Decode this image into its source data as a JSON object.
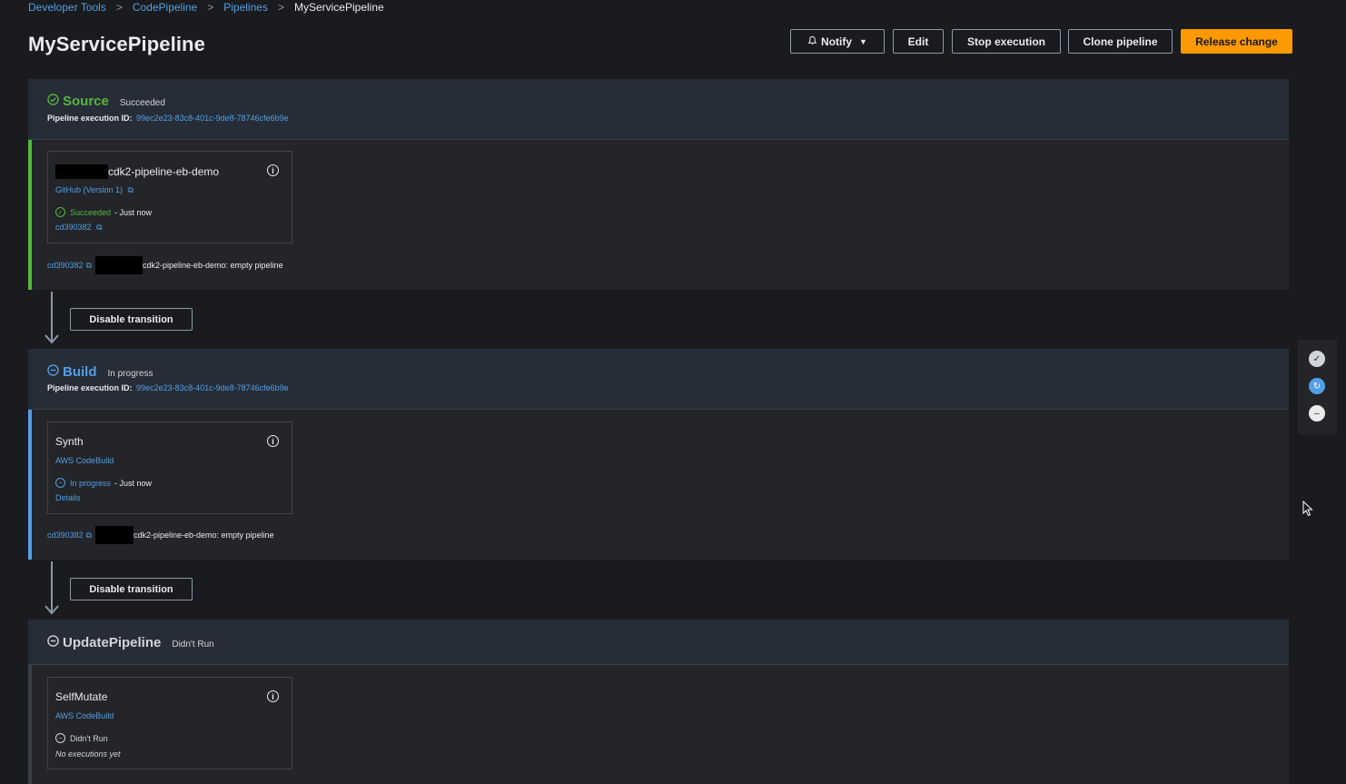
{
  "breadcrumb": {
    "items": [
      "Developer Tools",
      "CodePipeline",
      "Pipelines"
    ],
    "current": "MyServicePipeline"
  },
  "page": {
    "title": "MyServicePipeline"
  },
  "header_buttons": {
    "notify": "Notify",
    "edit": "Edit",
    "stop": "Stop execution",
    "clone": "Clone pipeline",
    "release": "Release change"
  },
  "colors": {
    "success": "#57b53c",
    "in_progress": "#539fe5",
    "didnt_run": "#d1d5db",
    "primary_button": "#ff9900"
  },
  "stages": [
    {
      "name": "Source",
      "status": "Succeeded",
      "exec_label": "Pipeline execution ID:",
      "exec_id": "99ec2e23-83c8-401c-9de8-78746cfe6b9e",
      "action": {
        "name": "cdk2-pipeline-eb-demo",
        "provider": "GitHub (Version 1)",
        "status": "Succeeded",
        "time": "- Just now",
        "sub": "cd390382"
      },
      "commit": {
        "id": "cd390382",
        "message": "cdk2-pipeline-eb-demo: empty pipeline"
      }
    },
    {
      "name": "Build",
      "status": "In progress",
      "exec_label": "Pipeline execution ID:",
      "exec_id": "99ec2e23-83c8-401c-9de8-78746cfe6b9e",
      "action": {
        "name": "Synth",
        "provider": "AWS CodeBuild",
        "status": "In progress",
        "time": "- Just now",
        "sub": "Details"
      },
      "commit": {
        "id": "cd390382",
        "message": "cdk2-pipeline-eb-demo: empty pipeline"
      }
    },
    {
      "name": "UpdatePipeline",
      "status": "Didn't Run",
      "action": {
        "name": "SelfMutate",
        "provider": "AWS CodeBuild",
        "status": "Didn't Run",
        "sub": "No executions yet"
      }
    }
  ],
  "transitions": {
    "label": "Disable transition"
  }
}
